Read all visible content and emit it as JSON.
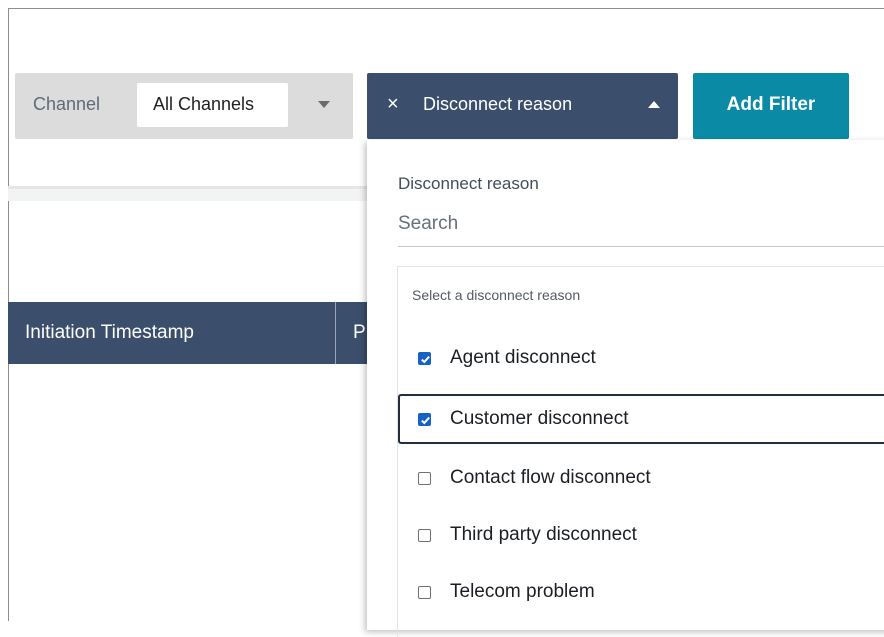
{
  "channel_filter": {
    "label": "Channel",
    "selected": "All Channels"
  },
  "disconnect_filter": {
    "close_symbol": "×",
    "label": "Disconnect reason"
  },
  "add_filter_label": "Add Filter",
  "table": {
    "columns": [
      "Initiation Timestamp",
      "P"
    ]
  },
  "dropdown": {
    "title": "Disconnect reason",
    "search_placeholder": "Search",
    "hint": "Select a disconnect reason",
    "options": [
      {
        "label": "Agent disconnect",
        "checked": true
      },
      {
        "label": "Customer disconnect",
        "checked": true
      },
      {
        "label": "Contact flow disconnect",
        "checked": false
      },
      {
        "label": "Third party disconnect",
        "checked": false
      },
      {
        "label": "Telecom problem",
        "checked": false
      }
    ]
  },
  "colors": {
    "header_navy": "#3b4e6b",
    "accent_teal": "#0b8aa6",
    "checkbox_blue": "#1662c4"
  }
}
